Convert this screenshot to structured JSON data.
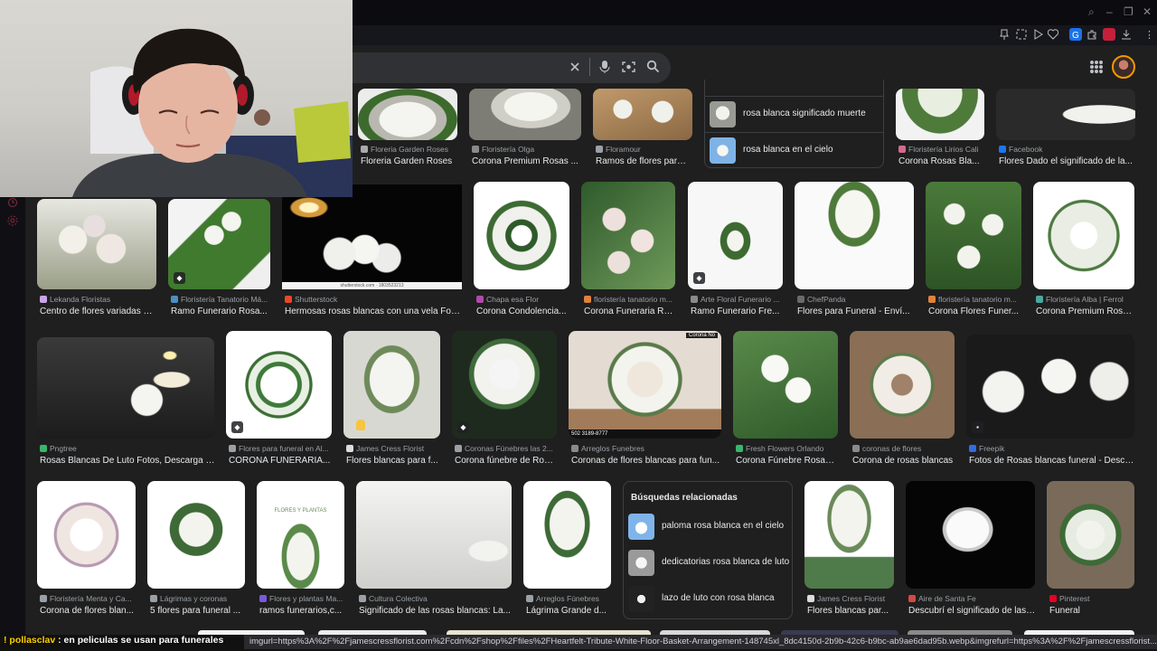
{
  "browser": {
    "window_controls": [
      "⌕",
      "–",
      "❐",
      "✕"
    ]
  },
  "search": {
    "clear_icon": "close-icon",
    "voice_icon": "mic-icon",
    "lens_icon": "lens-icon",
    "search_icon": "search-icon"
  },
  "row0": [
    {
      "source": "Floreria Garden Roses",
      "title": "Floreria Garden Roses",
      "fav": "#aaaaaa"
    },
    {
      "source": "Floristería Olga",
      "title": "Corona Premium Rosas ...",
      "fav": "#8a8a8a"
    },
    {
      "source": "Floramour",
      "title": "Ramos de flores para ...",
      "fav": "#9aa0a6"
    },
    {
      "source": "Floristería Lirios Cali",
      "title": "Corona Rosas Bla...",
      "fav": "#d26a8f"
    },
    {
      "source": "Facebook",
      "title": "Flores Dado el significado de la...",
      "fav": "#1877f2"
    }
  ],
  "related_top": [
    {
      "label": "rosa blanca significado muerte"
    },
    {
      "label": "rosa blanca en el cielo"
    }
  ],
  "row1": [
    {
      "source": "Lekanda Floristas",
      "title": "Centro de flores variadas b...",
      "fav": "#c9a4e8"
    },
    {
      "source": "Floristería Tanatorio Má...",
      "title": "Ramo Funerario Rosa...",
      "fav": "#4a90c2"
    },
    {
      "source": "Shutterstock",
      "title": "Hermosas rosas blancas con una vela Fot...",
      "fav": "#e8472b"
    },
    {
      "source": "Chapa esa Flor",
      "title": "Corona Condolencia...",
      "fav": "#b04aa8"
    },
    {
      "source": "floristería tanatorio m...",
      "title": "Corona Funeraria Ro...",
      "fav": "#e0823a"
    },
    {
      "source": "Arte Floral Funerario ...",
      "title": "Ramo Funerario Fre...",
      "fav": "#8a8a8a"
    },
    {
      "source": "ChefPanda",
      "title": "Flores para Funeral - Enví...",
      "fav": "#6a6a6a"
    },
    {
      "source": "floristería tanatorio m...",
      "title": "Corona Flores Funer...",
      "fav": "#e0823a"
    },
    {
      "source": "Floristería Alba | Ferrol",
      "title": "Corona Premium Rosa...",
      "fav": "#4aa8a0"
    }
  ],
  "shutter_caption": "shutterstock.com · 1803523213",
  "row2": [
    {
      "source": "Pngtree",
      "title": "Rosas Blancas De Luto Fotos, Descarga I...",
      "fav": "#3ab56b"
    },
    {
      "source": "Flores para funeral en Al...",
      "title": "CORONA FUNERARIA...",
      "fav": "#9aa0a6"
    },
    {
      "source": "James Cress Florist",
      "title": "Flores blancas para f...",
      "fav": "#dcdcdc"
    },
    {
      "source": "Coronas Fúnebres las 2...",
      "title": "Corona fúnebre de Ros...",
      "fav": "#9aa0a6"
    },
    {
      "source": "Arreglos Funebres",
      "title": "Coronas de flores blancas para fun...",
      "fav": "#8a8a8a"
    },
    {
      "source": "Fresh Flowers Orlando",
      "title": "Corona Fúnebre Rosas...",
      "fav": "#3ab56b"
    },
    {
      "source": "coronas de flores",
      "title": "Corona de rosas blancas",
      "fav": "#8a8a8a"
    },
    {
      "source": "Freepik",
      "title": "Fotos de Rosas blancas funeral - Desca...",
      "fav": "#2f6de1"
    }
  ],
  "corona_tag": "Corona No",
  "phone_text": "502 3189-8777",
  "row3": [
    {
      "source": "Floristería Menta y Ca...",
      "title": "Corona de flores blan...",
      "fav": "#9aa0a6"
    },
    {
      "source": "Lágrimas y coronas",
      "title": "5 flores para funeral ...",
      "fav": "#9aa0a6"
    },
    {
      "source": "Flores y plantas Ma...",
      "title": "ramos funerarios,c...",
      "fav": "#7a5ad8"
    },
    {
      "source": "Cultura Colectiva",
      "title": "Significado de las rosas blancas: La...",
      "fav": "#9aa0a6"
    },
    {
      "source": "Arreglos Fúnebres",
      "title": "Lágrima Grande d...",
      "fav": "#9aa0a6"
    },
    {
      "source": "James Cress Florist",
      "title": "Flores blancas par...",
      "fav": "#dcdcdc"
    },
    {
      "source": "Aire de Santa Fe",
      "title": "Descubrí el significado de las ...",
      "fav": "#d04a4a"
    },
    {
      "source": "Pinterest",
      "title": "Funeral",
      "fav": "#e60023"
    }
  ],
  "flores_text": "FLORES Y PLANTAS",
  "related_panel": {
    "heading": "Búsquedas relacionadas",
    "items": [
      {
        "label": "paloma rosa blanca en el cielo"
      },
      {
        "label": "dedicatorias rosa blanca de luto"
      },
      {
        "label": "lazo de luto con rosa blanca"
      }
    ]
  },
  "subtitle": {
    "warn": "!",
    "prefix": " pollasclav",
    "text": " : en peliculas se usan para funerales"
  },
  "status_url": "imgurl=https%3A%2F%2Fjamescressflorist.com%2Fcdn%2Fshop%2Ffiles%2FHeartfelt-Tribute-White-Floor-Basket-Arrangement-148745xl_8dc4150d-2b9b-42c6-b9bc-ab9ae6dad95b.webp&imgrefurl=https%3A%2F%2Fjamescressflorist....",
  "sidebar_gx": "GX"
}
